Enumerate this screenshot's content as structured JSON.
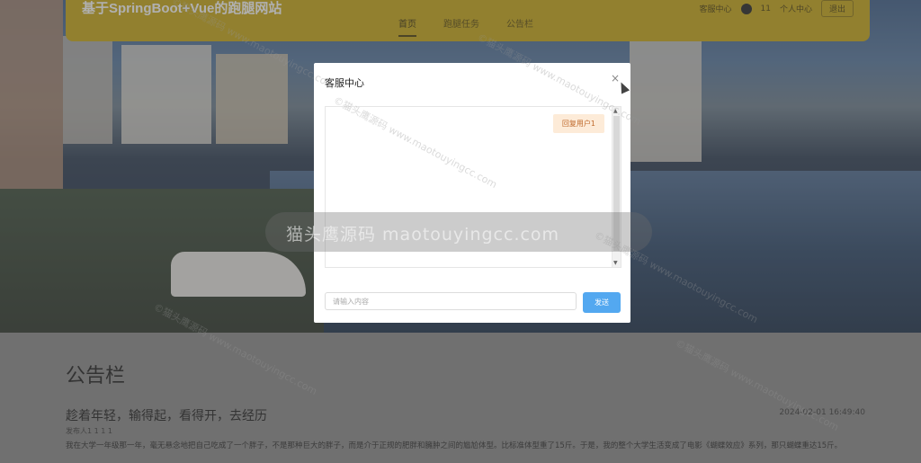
{
  "navbar": {
    "site_title": "基于SpringBoot+Vue的跑腿网站",
    "menu": [
      {
        "label": "首页",
        "active": true
      },
      {
        "label": "跑腿任务",
        "active": false
      },
      {
        "label": "公告栏",
        "active": false
      }
    ],
    "customer_service": "客服中心",
    "user_number": "11",
    "personal_center": "个人中心",
    "logout": "退出"
  },
  "notice": {
    "board_title": "公告栏",
    "post_title": "趁着年轻，输得起，看得开，去经历",
    "post_date": "2024-02-01 16:49:40",
    "post_meta": "发布人1   1   1   1",
    "post_body": "我在大学一年级那一年，毫无悬念地把自己吃成了一个胖子，不是那种巨大的胖子，而是介于正规的肥胖和臃肿之间的尴尬体型。比标准体型重了15斤。于是，我的整个大学生活变成了电影《蝴蝶效应》系列，那只蝴蝶重达15斤。"
  },
  "modal": {
    "title": "客服中心",
    "close": "×",
    "reply_bubble": "回复用户1",
    "input_placeholder": "请输入内容",
    "send_label": "发送"
  },
  "watermark": {
    "center": "猫头鹰源码 maotouyingcc.com",
    "diagonal": "©猫头鹰源码 www.maotouyingcc.com"
  }
}
